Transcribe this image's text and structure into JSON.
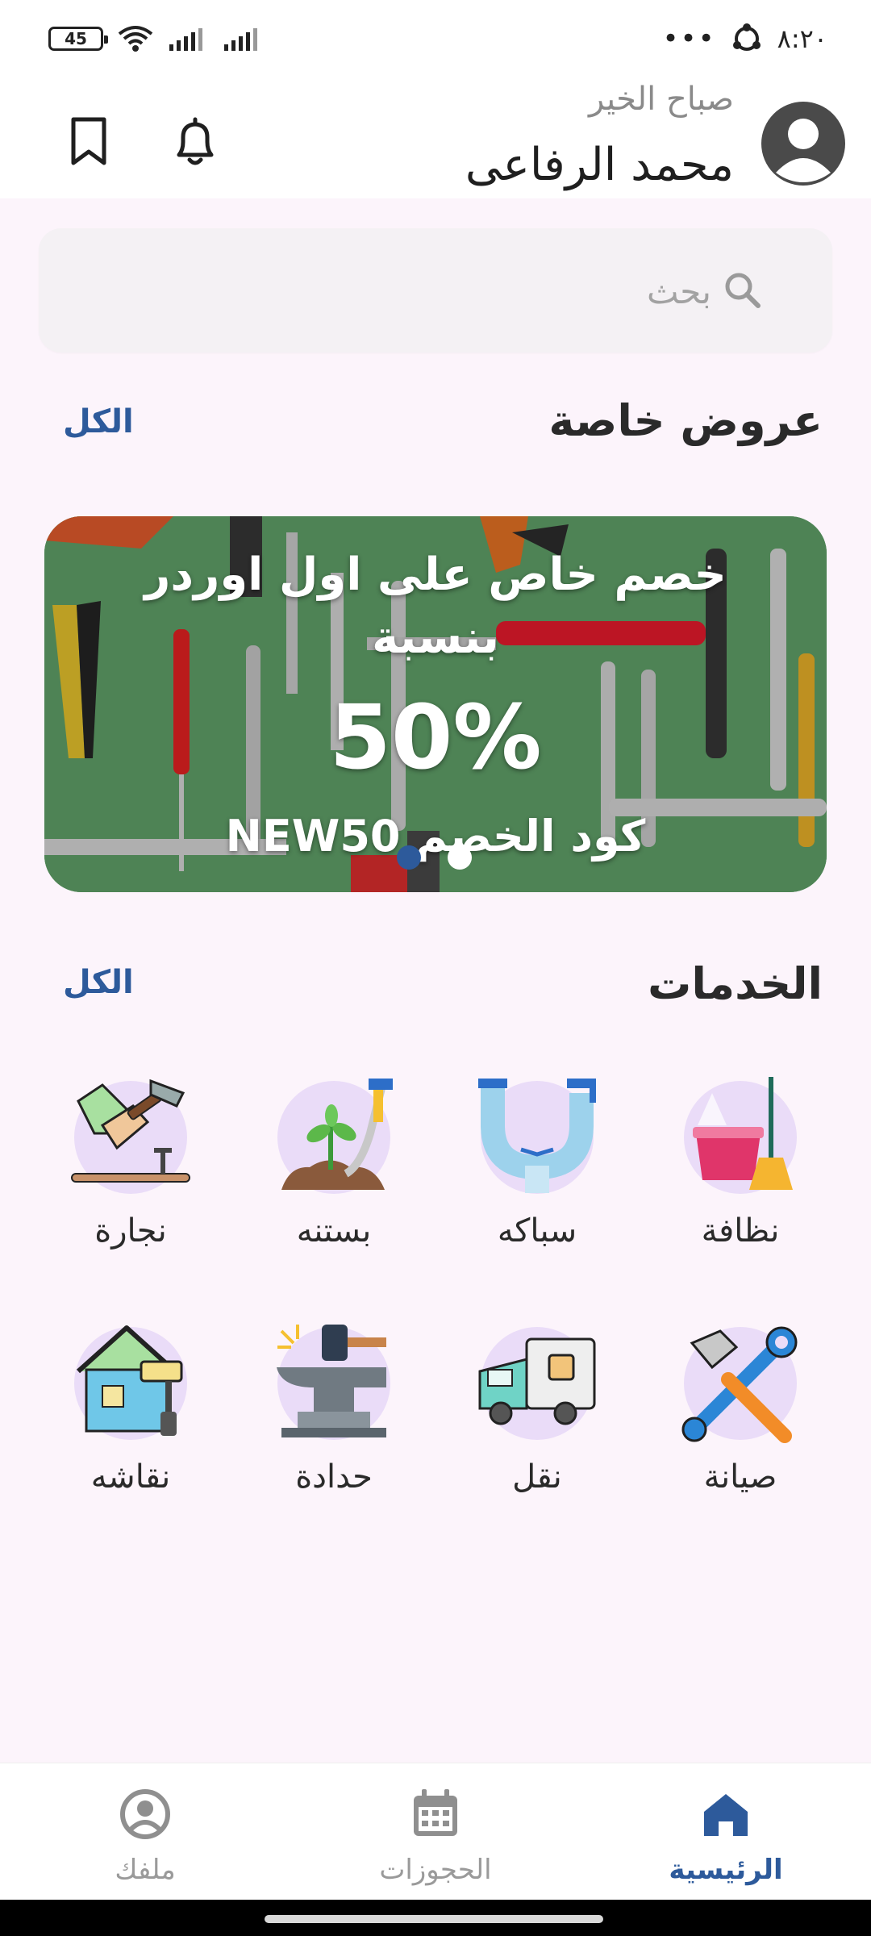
{
  "status_bar": {
    "battery": "45",
    "time": "٨:٢٠"
  },
  "header": {
    "greeting": "صباح الخير",
    "user_name": "محمد الرفاعى"
  },
  "search": {
    "placeholder": "بحث"
  },
  "offers": {
    "title": "عروض خاصة",
    "see_all": "الكل",
    "banner": {
      "line1": "خصم خاص على اول اوردر",
      "line2": "بنسبة",
      "percent": "50%",
      "code": "كود الخصم NEW50",
      "slides": 2,
      "active_slide": 1
    }
  },
  "services": {
    "title": "الخدمات",
    "see_all": "الكل",
    "items": [
      {
        "label": "نظافة",
        "icon": "cleaning-icon"
      },
      {
        "label": "سباكه",
        "icon": "plumbing-icon"
      },
      {
        "label": "بستنه",
        "icon": "gardening-icon"
      },
      {
        "label": "نجارة",
        "icon": "carpentry-icon"
      },
      {
        "label": "صيانة",
        "icon": "maintenance-icon"
      },
      {
        "label": "نقل",
        "icon": "moving-truck-icon"
      },
      {
        "label": "حدادة",
        "icon": "anvil-icon"
      },
      {
        "label": "نقاشه",
        "icon": "painting-icon"
      }
    ]
  },
  "bottom_nav": {
    "items": [
      {
        "label": "الرئيسية",
        "icon": "home-icon",
        "active": true
      },
      {
        "label": "الحجوزات",
        "icon": "calendar-icon",
        "active": false
      },
      {
        "label": "ملفك",
        "icon": "profile-icon",
        "active": false
      }
    ]
  },
  "colors": {
    "accent": "#2d5a9b",
    "background": "#fcf4fb",
    "icon_circle": "#eadcf8"
  }
}
